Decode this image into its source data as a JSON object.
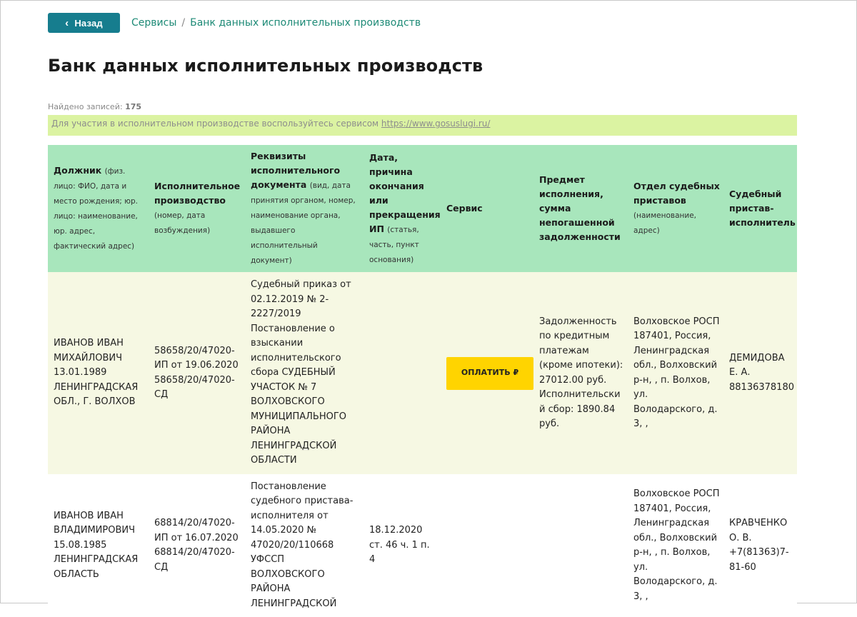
{
  "nav": {
    "back_label": "Назад",
    "breadcrumb": [
      "Сервисы",
      "Банк данных исполнительных производств"
    ]
  },
  "page": {
    "title": "Банк данных исполнительных производств",
    "found_label": "Найдено записей:",
    "found_count": "175",
    "notice_text": "Для участия в исполнительном производстве воспользуйтесь сервисом ",
    "notice_link": "https://www.gosuslugi.ru/"
  },
  "table": {
    "headers": [
      {
        "title": "Должник",
        "note": "(физ. лицо: ФИО, дата и место рождения; юр. лицо: наименование, юр. адрес, фактический адрес)"
      },
      {
        "title": "Исполнительное производство",
        "note": "(номер, дата возбуждения)"
      },
      {
        "title": "Реквизиты исполнительного документа",
        "note": "(вид, дата принятия органом, номер, наименование органа, выдавшего исполнительный документ)"
      },
      {
        "title": "Дата, причина окончания или прекращения ИП",
        "note": "(статья, часть, пункт основания)"
      },
      {
        "title": "Сервис",
        "note": ""
      },
      {
        "title": "Предмет исполнения, сумма непогашенной задолженности",
        "note": ""
      },
      {
        "title": "Отдел судебных приставов",
        "note": "(наименование, адрес)"
      },
      {
        "title": "Судебный пристав-исполнитель",
        "note": ""
      }
    ],
    "rows": [
      {
        "debtor": "ИВАНОВ ИВАН МИХАЙЛОВИЧ 13.01.1989 ЛЕНИНГРАДСКАЯ ОБЛ., Г. ВОЛХОВ",
        "proceeding": "58658/20/47020-ИП от 19.06.2020 58658/20/47020-СД",
        "document": "Судебный приказ от 02.12.2019 № 2-2227/2019 Постановление о взыскании исполнительского сбора СУДЕБНЫЙ УЧАСТОК № 7 ВОЛХОВСКОГО МУНИЦИПАЛЬНОГО РАЙОНА ЛЕНИНГРАДСКОЙ ОБЛАСТИ",
        "end_reason": "",
        "service_button": "ОПЛАТИТЬ ₽",
        "subject": "Задолженность по кредитным платежам (кроме ипотеки): 27012.00 руб. Исполнительский сбор: 1890.84 руб.",
        "department": "Волховское РОСП 187401, Россия, Ленинградская обл., Волховский р-н, , п. Волхов, ул. Володарского, д. 3, ,",
        "bailiff": "ДЕМИДОВА Е. А. 88136378180"
      },
      {
        "debtor": "ИВАНОВ ИВАН ВЛАДИМИРОВИЧ 15.08.1985 ЛЕНИНГРАДСКАЯ ОБЛАСТЬ",
        "proceeding": "68814/20/47020-ИП от 16.07.2020 68814/20/47020-СД",
        "document": "Постановление судебного пристава-исполнителя от 14.05.2020 № 47020/20/110668 УФССП ВОЛХОВСКОГО РАЙОНА ЛЕНИНГРАДСКОЙ",
        "end_reason": "18.12.2020 ст. 46 ч. 1 п. 4",
        "service_button": "",
        "subject": "",
        "department": "Волховское РОСП 187401, Россия, Ленинградская обл., Волховский р-н, , п. Волхов, ул. Володарского, д. 3, ,",
        "bailiff": "КРАВЧЕНКО О. В. +7(81363)7-81-60"
      }
    ]
  },
  "colors": {
    "back_button": "#167d8e",
    "breadcrumb_link": "#1d8a76",
    "notice_bg": "#dbf3a2",
    "header_bg": "#a8e6bc",
    "row_highlight": "#f6f8e3",
    "pay_button": "#ffd400"
  }
}
